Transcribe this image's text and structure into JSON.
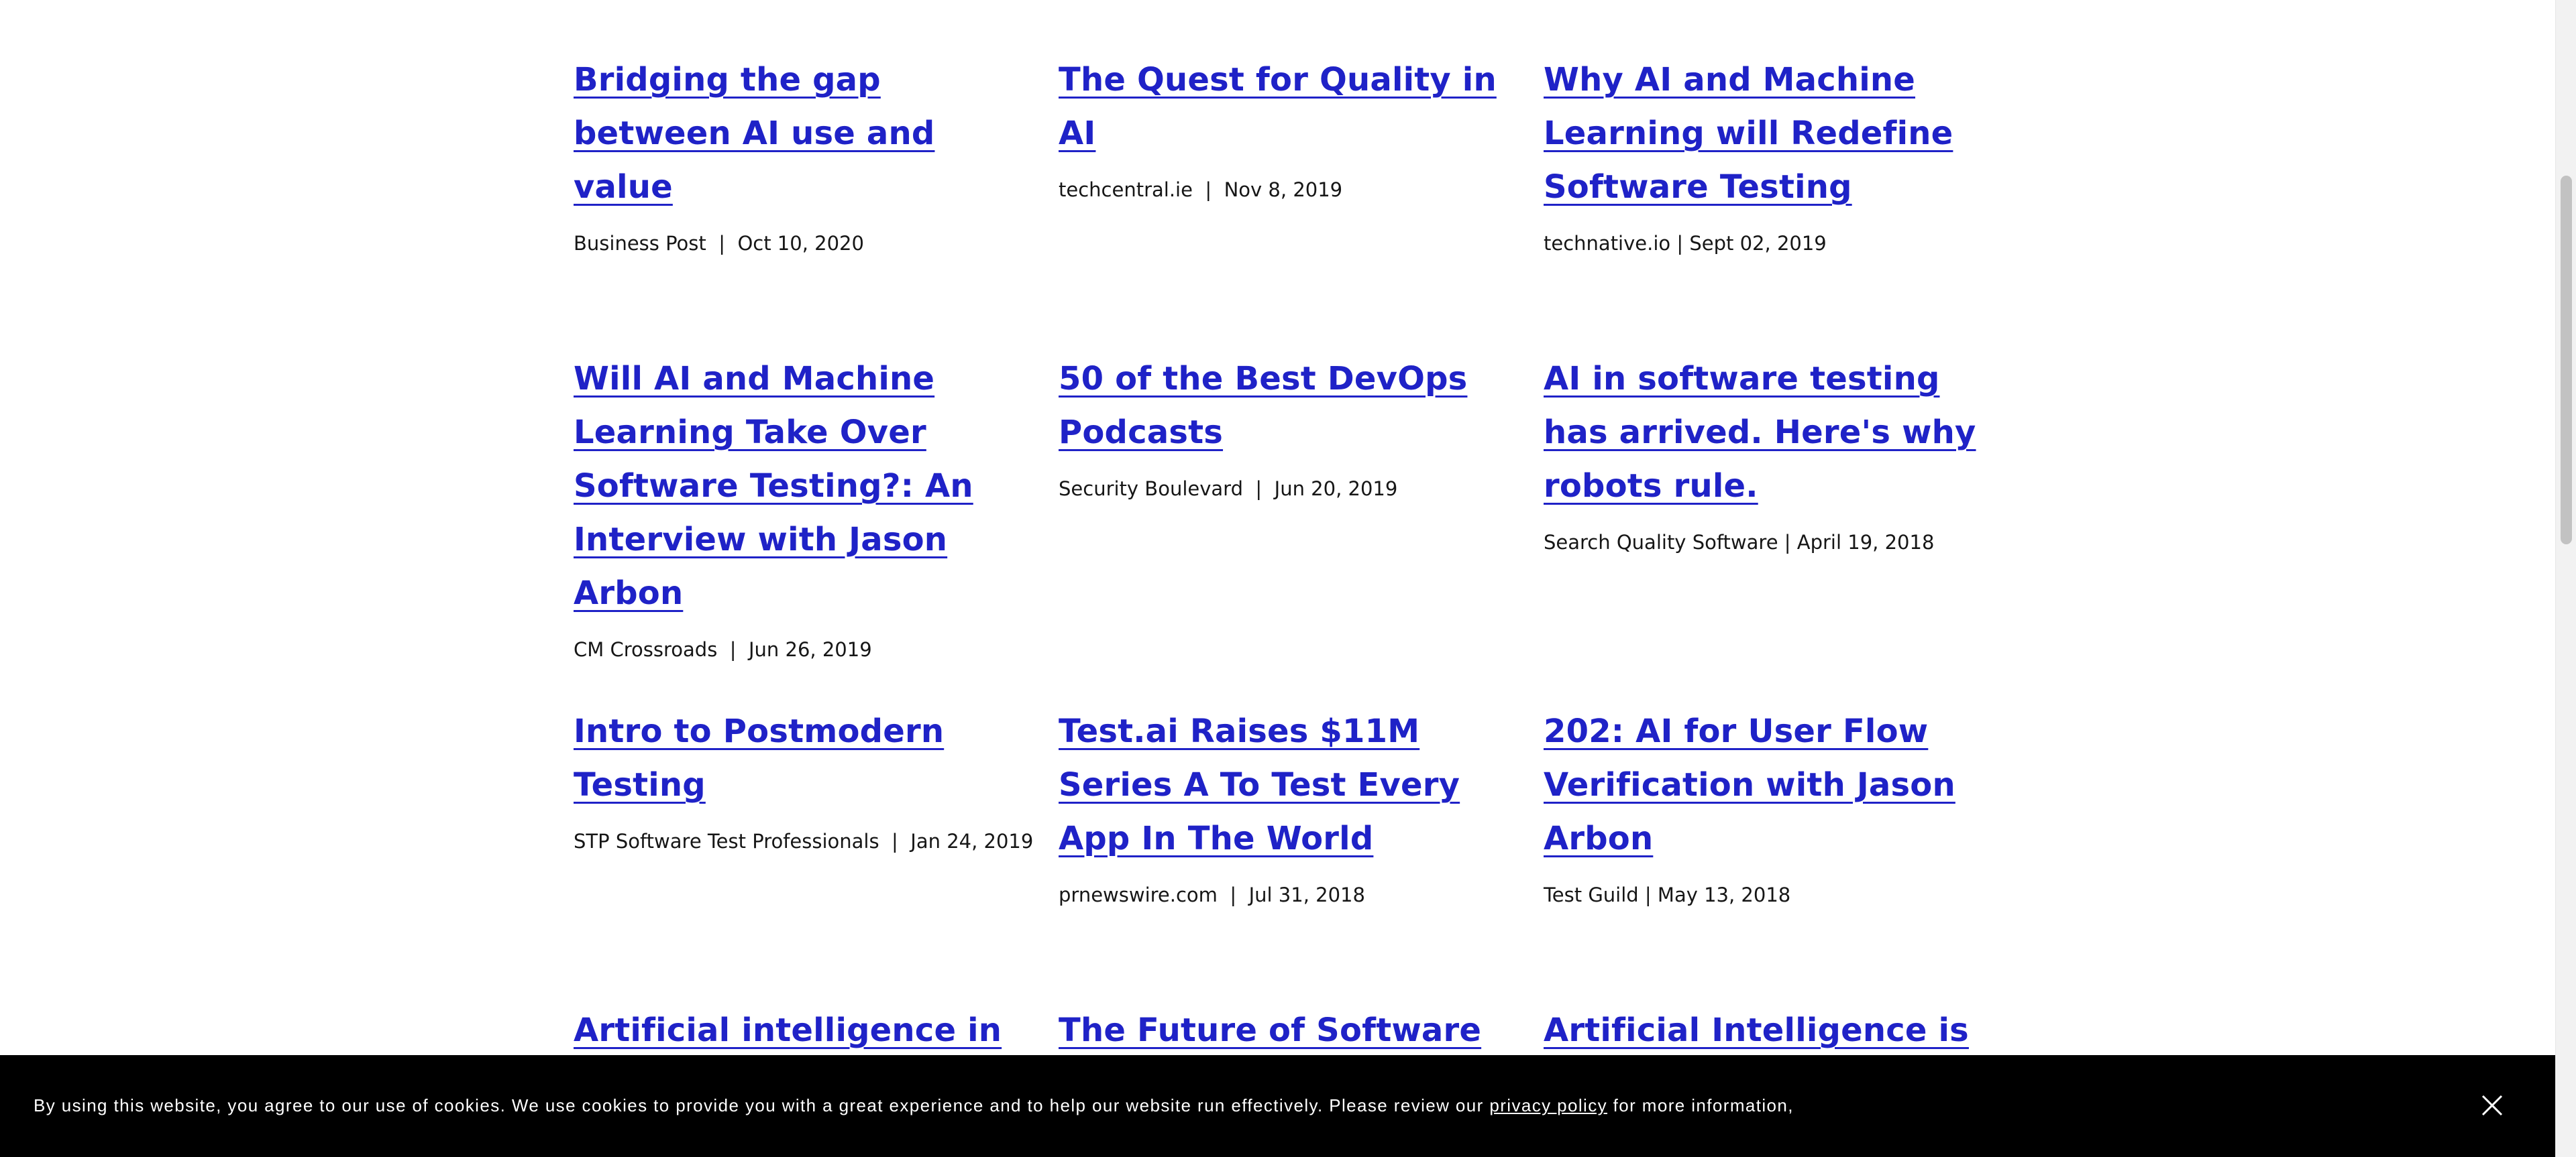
{
  "articles": [
    {
      "title": "Bridging the gap between AI use and value",
      "source": "Business Post",
      "separator": "  |  ",
      "date": "Oct 10, 2020"
    },
    {
      "title": "The Quest for Quality in AI",
      "source": "techcentral.ie",
      "separator": "  |  ",
      "date": "Nov 8, 2019"
    },
    {
      "title": "Why AI and Machine Learning will Redefine Software Testing",
      "source": "technative.io",
      "separator": " | ",
      "date": "Sept 02, 2019"
    },
    {
      "title": "Will AI and Machine Learning Take Over Software Testing?: An Interview with Jason Arbon",
      "source": "CM Crossroads",
      "separator": "  |  ",
      "date": "Jun 26, 2019"
    },
    {
      "title": "50 of the Best DevOps Podcasts",
      "source": "Security Boulevard",
      "separator": "  |  ",
      "date": "Jun 20, 2019"
    },
    {
      "title": "AI in software testing has arrived. Here's why robots rule.",
      "source": "Search Quality Software",
      "separator": " | ",
      "date": "April 19, 2018"
    },
    {
      "title": "Intro to Postmodern Testing",
      "source": "STP Software Test Professionals",
      "separator": "  |  ",
      "date": "Jan 24, 2019"
    },
    {
      "title": "Test.ai Raises $11M Series A To Test Every App In The World",
      "source": "prnewswire.com",
      "separator": "  |  ",
      "date": "Jul 31, 2018"
    },
    {
      "title": "202: AI for User Flow Verification with Jason Arbon",
      "source": "Test Guild",
      "separator": " | ",
      "date": "May 13, 2018"
    },
    {
      "title": "Artificial intelligence in",
      "source": "",
      "separator": "",
      "date": ""
    },
    {
      "title": "The Future of Software Testing",
      "source": "",
      "separator": "",
      "date": ""
    },
    {
      "title": "Artificial Intelligence is",
      "source": "",
      "separator": "",
      "date": ""
    }
  ],
  "cookie_banner": {
    "text_before": "By using this website, you agree to our use of cookies. We use cookies to provide you with a great experience and to help our website run effectively. Please review our ",
    "link_text": "privacy policy",
    "text_after": " for more information,",
    "close_icon": "close-icon"
  },
  "colors": {
    "link": "#1f22c7",
    "text": "#161616",
    "banner_bg": "#000000",
    "banner_text": "#ffffff"
  }
}
